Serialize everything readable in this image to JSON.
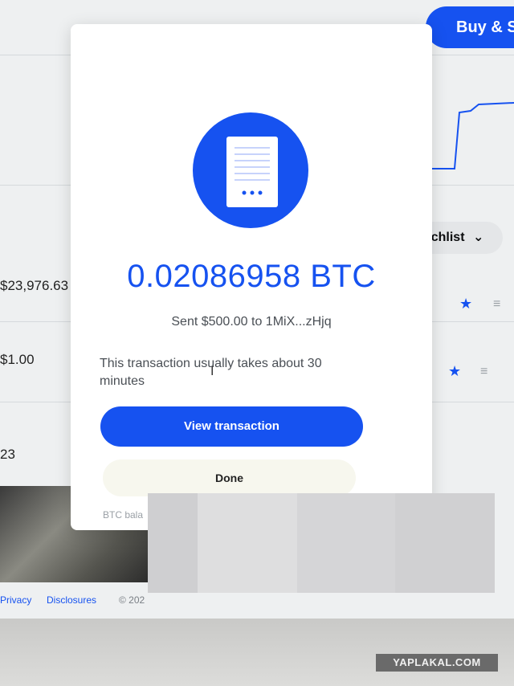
{
  "background": {
    "buy_sell_label": "Buy & Se",
    "watchlist_label": "Watchlist",
    "prices": [
      "$23,976.63",
      "$1.00",
      "23"
    ],
    "footer": {
      "privacy": "Privacy",
      "disclosures": "Disclosures",
      "copyright": "© 202"
    }
  },
  "modal": {
    "icon": "receipt-icon",
    "amount": "0.02086958 BTC",
    "sent_text": "Sent $500.00 to 1MiX...zHjq",
    "note": "This transaction usually takes about 30 minutes",
    "view_button": "View transaction",
    "done_button": "Done",
    "btc_balance_label": "BTC bala"
  },
  "watermark": "YAPLAKAL.COM",
  "colors": {
    "accent": "#1652f0",
    "modal_bg": "#ffffff",
    "page_bg": "#eef0f1"
  }
}
